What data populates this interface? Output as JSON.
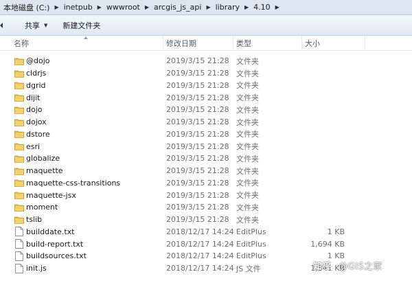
{
  "address_bar": {
    "crumbs": [
      "本地磁盘 (C:)",
      "inetpub",
      "wwwroot",
      "arcgis_js_api",
      "library",
      "4.10"
    ]
  },
  "toolbar": {
    "share_label": "共享",
    "new_folder_label": "新建文件夹"
  },
  "columns": {
    "name": "名称",
    "date": "修改日期",
    "type": "类型",
    "size": "大小"
  },
  "files": [
    {
      "name": "@dojo",
      "date": "2019/3/15 21:28",
      "type": "文件夹",
      "size": "",
      "icon": "folder-icon"
    },
    {
      "name": "cldrjs",
      "date": "2019/3/15 21:28",
      "type": "文件夹",
      "size": "",
      "icon": "folder-icon"
    },
    {
      "name": "dgrid",
      "date": "2019/3/15 21:28",
      "type": "文件夹",
      "size": "",
      "icon": "folder-icon"
    },
    {
      "name": "dijit",
      "date": "2019/3/15 21:28",
      "type": "文件夹",
      "size": "",
      "icon": "folder-icon"
    },
    {
      "name": "dojo",
      "date": "2019/3/15 21:28",
      "type": "文件夹",
      "size": "",
      "icon": "folder-icon"
    },
    {
      "name": "dojox",
      "date": "2019/3/15 21:28",
      "type": "文件夹",
      "size": "",
      "icon": "folder-icon"
    },
    {
      "name": "dstore",
      "date": "2019/3/15 21:28",
      "type": "文件夹",
      "size": "",
      "icon": "folder-icon"
    },
    {
      "name": "esri",
      "date": "2019/3/15 21:28",
      "type": "文件夹",
      "size": "",
      "icon": "folder-icon"
    },
    {
      "name": "globalize",
      "date": "2019/3/15 21:28",
      "type": "文件夹",
      "size": "",
      "icon": "folder-icon"
    },
    {
      "name": "maquette",
      "date": "2019/3/15 21:28",
      "type": "文件夹",
      "size": "",
      "icon": "folder-icon"
    },
    {
      "name": "maquette-css-transitions",
      "date": "2019/3/15 21:28",
      "type": "文件夹",
      "size": "",
      "icon": "folder-icon"
    },
    {
      "name": "maquette-jsx",
      "date": "2019/3/15 21:28",
      "type": "文件夹",
      "size": "",
      "icon": "folder-icon"
    },
    {
      "name": "moment",
      "date": "2019/3/15 21:28",
      "type": "文件夹",
      "size": "",
      "icon": "folder-icon"
    },
    {
      "name": "tslib",
      "date": "2019/3/15 21:28",
      "type": "文件夹",
      "size": "",
      "icon": "folder-icon"
    },
    {
      "name": "builddate.txt",
      "date": "2018/12/17 14:24",
      "type": "EditPlus",
      "size": "1 KB",
      "icon": "file-icon"
    },
    {
      "name": "build-report.txt",
      "date": "2018/12/17 14:24",
      "type": "EditPlus",
      "size": "1,694 KB",
      "icon": "file-icon"
    },
    {
      "name": "buildsources.txt",
      "date": "2018/12/17 14:24",
      "type": "EditPlus",
      "size": "1 KB",
      "icon": "file-icon"
    },
    {
      "name": "init.js",
      "date": "2018/12/17 14:24",
      "type": "JS 文件",
      "size": "1,341 KB",
      "icon": "file-icon"
    }
  ],
  "watermark": {
    "brand": "知乎",
    "handle": "@GIS之家"
  },
  "colors": {
    "address_bg": "#dde6f0",
    "toolbar_top": "#f3f7fc",
    "toolbar_bottom": "#dfe8f3",
    "folder_yellow": "#e8c04a",
    "header_text": "#4c607a",
    "meta_text": "#6d6d6d"
  }
}
